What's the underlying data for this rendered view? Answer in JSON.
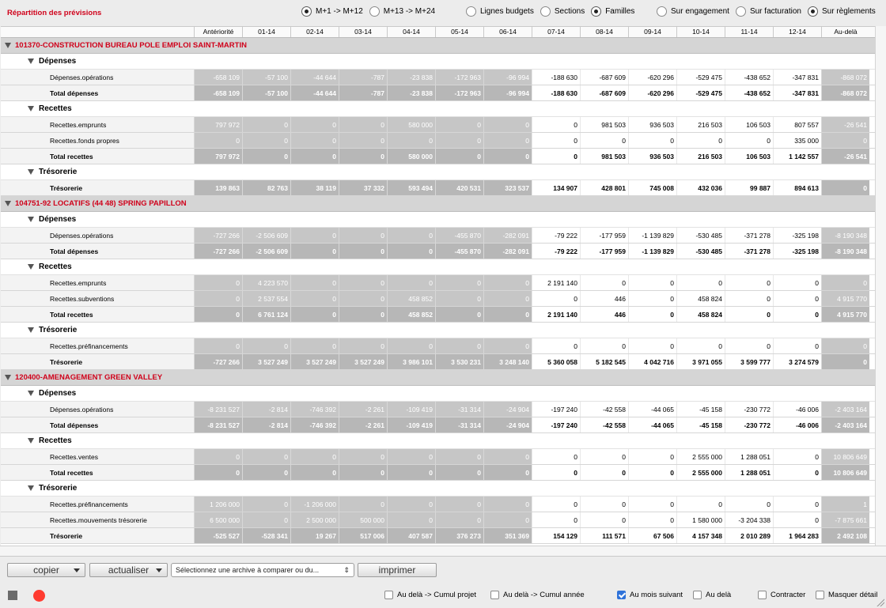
{
  "app_title": "Répartition des prévisions",
  "horizon_options": [
    {
      "label": "M+1 -> M+12",
      "selected": true
    },
    {
      "label": "M+13 -> M+24",
      "selected": false
    }
  ],
  "grouping_options": [
    {
      "label": "Lignes budgets",
      "selected": false
    },
    {
      "label": "Sections",
      "selected": false
    },
    {
      "label": "Familles",
      "selected": true
    }
  ],
  "basis_options": [
    {
      "label": "Sur engagement",
      "selected": false
    },
    {
      "label": "Sur facturation",
      "selected": false
    },
    {
      "label": "Sur règlements",
      "selected": true
    }
  ],
  "columns": [
    "Antériorité",
    "01-14",
    "02-14",
    "03-14",
    "04-14",
    "05-14",
    "06-14",
    "07-14",
    "08-14",
    "09-14",
    "10-14",
    "11-14",
    "12-14",
    "Au-delà"
  ],
  "rows": [
    {
      "type": "proj",
      "label": "101370-CONSTRUCTION BUREAU POLE EMPLOI SAINT-MARTIN"
    },
    {
      "type": "sect",
      "label": "Dépenses"
    },
    {
      "type": "line",
      "label": "Dépenses.opérations",
      "vals": [
        "-658 109",
        "-57 100",
        "-44 644",
        "-787",
        "-23 838",
        "-172 963",
        "-96 994",
        "-188 630",
        "-687 609",
        "-620 296",
        "-529 475",
        "-438 652",
        "-347 831",
        "-868 072"
      ]
    },
    {
      "type": "tot",
      "label": "Total dépenses",
      "vals": [
        "-658 109",
        "-57 100",
        "-44 644",
        "-787",
        "-23 838",
        "-172 963",
        "-96 994",
        "-188 630",
        "-687 609",
        "-620 296",
        "-529 475",
        "-438 652",
        "-347 831",
        "-868 072"
      ]
    },
    {
      "type": "sect",
      "label": "Recettes"
    },
    {
      "type": "line",
      "label": "Recettes.emprunts",
      "vals": [
        "797 972",
        "0",
        "0",
        "0",
        "580 000",
        "0",
        "0",
        "0",
        "981 503",
        "936 503",
        "216 503",
        "106 503",
        "807 557",
        "-26 541"
      ]
    },
    {
      "type": "line",
      "label": "Recettes.fonds propres",
      "vals": [
        "0",
        "0",
        "0",
        "0",
        "0",
        "0",
        "0",
        "0",
        "0",
        "0",
        "0",
        "0",
        "335 000",
        "0"
      ]
    },
    {
      "type": "tot",
      "label": "Total recettes",
      "vals": [
        "797 972",
        "0",
        "0",
        "0",
        "580 000",
        "0",
        "0",
        "0",
        "981 503",
        "936 503",
        "216 503",
        "106 503",
        "1 142 557",
        "-26 541"
      ]
    },
    {
      "type": "sect",
      "label": "Trésorerie"
    },
    {
      "type": "tot",
      "label": "Trésorerie",
      "vals": [
        "139 863",
        "82 763",
        "38 119",
        "37 332",
        "593 494",
        "420 531",
        "323 537",
        "134 907",
        "428 801",
        "745 008",
        "432 036",
        "99 887",
        "894 613",
        "0"
      ]
    },
    {
      "type": "proj",
      "label": "104751-92 LOCATIFS (44 48) SPRING PAPILLON"
    },
    {
      "type": "sect",
      "label": "Dépenses"
    },
    {
      "type": "line",
      "label": "Dépenses.opérations",
      "vals": [
        "-727 266",
        "-2 506 609",
        "0",
        "0",
        "0",
        "-455 870",
        "-282 091",
        "-79 222",
        "-177 959",
        "-1 139 829",
        "-530 485",
        "-371 278",
        "-325 198",
        "-8 190 348"
      ]
    },
    {
      "type": "tot",
      "label": "Total dépenses",
      "vals": [
        "-727 266",
        "-2 506 609",
        "0",
        "0",
        "0",
        "-455 870",
        "-282 091",
        "-79 222",
        "-177 959",
        "-1 139 829",
        "-530 485",
        "-371 278",
        "-325 198",
        "-8 190 348"
      ]
    },
    {
      "type": "sect",
      "label": "Recettes"
    },
    {
      "type": "line",
      "label": "Recettes.emprunts",
      "vals": [
        "0",
        "4 223 570",
        "0",
        "0",
        "0",
        "0",
        "0",
        "2 191 140",
        "0",
        "0",
        "0",
        "0",
        "0",
        "0"
      ]
    },
    {
      "type": "line",
      "label": "Recettes.subventions",
      "vals": [
        "0",
        "2 537 554",
        "0",
        "0",
        "458 852",
        "0",
        "0",
        "0",
        "446",
        "0",
        "458 824",
        "0",
        "0",
        "4 915 770"
      ]
    },
    {
      "type": "tot",
      "label": "Total recettes",
      "vals": [
        "0",
        "6 761 124",
        "0",
        "0",
        "458 852",
        "0",
        "0",
        "2 191 140",
        "446",
        "0",
        "458 824",
        "0",
        "0",
        "4 915 770"
      ]
    },
    {
      "type": "sect",
      "label": "Trésorerie"
    },
    {
      "type": "line",
      "label": "Recettes.préfinancements",
      "vals": [
        "0",
        "0",
        "0",
        "0",
        "0",
        "0",
        "0",
        "0",
        "0",
        "0",
        "0",
        "0",
        "0",
        "0"
      ]
    },
    {
      "type": "tot",
      "label": "Trésorerie",
      "vals": [
        "-727 266",
        "3 527 249",
        "3 527 249",
        "3 527 249",
        "3 986 101",
        "3 530 231",
        "3 248 140",
        "5 360 058",
        "5 182 545",
        "4 042 716",
        "3 971 055",
        "3 599 777",
        "3 274 579",
        "0"
      ]
    },
    {
      "type": "proj",
      "label": "120400-AMENAGEMENT GREEN VALLEY"
    },
    {
      "type": "sect",
      "label": "Dépenses"
    },
    {
      "type": "line",
      "label": "Dépenses.opérations",
      "vals": [
        "-8 231 527",
        "-2 814",
        "-746 392",
        "-2 261",
        "-109 419",
        "-31 314",
        "-24 904",
        "-197 240",
        "-42 558",
        "-44 065",
        "-45 158",
        "-230 772",
        "-46 006",
        "-2 403 164"
      ]
    },
    {
      "type": "tot",
      "label": "Total dépenses",
      "vals": [
        "-8 231 527",
        "-2 814",
        "-746 392",
        "-2 261",
        "-109 419",
        "-31 314",
        "-24 904",
        "-197 240",
        "-42 558",
        "-44 065",
        "-45 158",
        "-230 772",
        "-46 006",
        "-2 403 164"
      ]
    },
    {
      "type": "sect",
      "label": "Recettes"
    },
    {
      "type": "line",
      "label": "Recettes.ventes",
      "vals": [
        "0",
        "0",
        "0",
        "0",
        "0",
        "0",
        "0",
        "0",
        "0",
        "0",
        "2 555 000",
        "1 288 051",
        "0",
        "10 806 649"
      ]
    },
    {
      "type": "tot",
      "label": "Total recettes",
      "vals": [
        "0",
        "0",
        "0",
        "0",
        "0",
        "0",
        "0",
        "0",
        "0",
        "0",
        "2 555 000",
        "1 288 051",
        "0",
        "10 806 649"
      ]
    },
    {
      "type": "sect",
      "label": "Trésorerie"
    },
    {
      "type": "line",
      "label": "Recettes.préfinancements",
      "vals": [
        "1 206 000",
        "0",
        "-1 206 000",
        "0",
        "0",
        "0",
        "0",
        "0",
        "0",
        "0",
        "0",
        "0",
        "0",
        "1"
      ]
    },
    {
      "type": "line",
      "label": "Recettes.mouvements trésorerie",
      "vals": [
        "6 500 000",
        "0",
        "2 500 000",
        "500 000",
        "0",
        "0",
        "0",
        "0",
        "0",
        "0",
        "1 580 000",
        "-3 204 338",
        "0",
        "-7 875 661"
      ]
    },
    {
      "type": "tot",
      "label": "Trésorerie",
      "vals": [
        "-525 527",
        "-528 341",
        "19 267",
        "517 006",
        "407 587",
        "376 273",
        "351 369",
        "154 129",
        "111 571",
        "67 506",
        "4 157 348",
        "2 010 289",
        "1 964 283",
        "2 492 108"
      ]
    }
  ],
  "toolbar": {
    "copy_label": "copier",
    "refresh_label": "actualiser",
    "archive_select": "Sélectionnez une archive à comparer ou du...",
    "print_label": "imprimer"
  },
  "status_checks": [
    {
      "label": "Au delà -> Cumul projet",
      "checked": false
    },
    {
      "label": "Au delà -> Cumul année",
      "checked": false
    },
    {
      "label": "Au mois suivant",
      "checked": true
    },
    {
      "label": "Au delà",
      "checked": false
    },
    {
      "label": "Contracter",
      "checked": false
    },
    {
      "label": "Masquer détail",
      "checked": false
    }
  ],
  "colors": {
    "accent_red": "#d0021b",
    "grey_cell": "#c6c6c6",
    "checkbox_blue": "#2f72d9"
  }
}
